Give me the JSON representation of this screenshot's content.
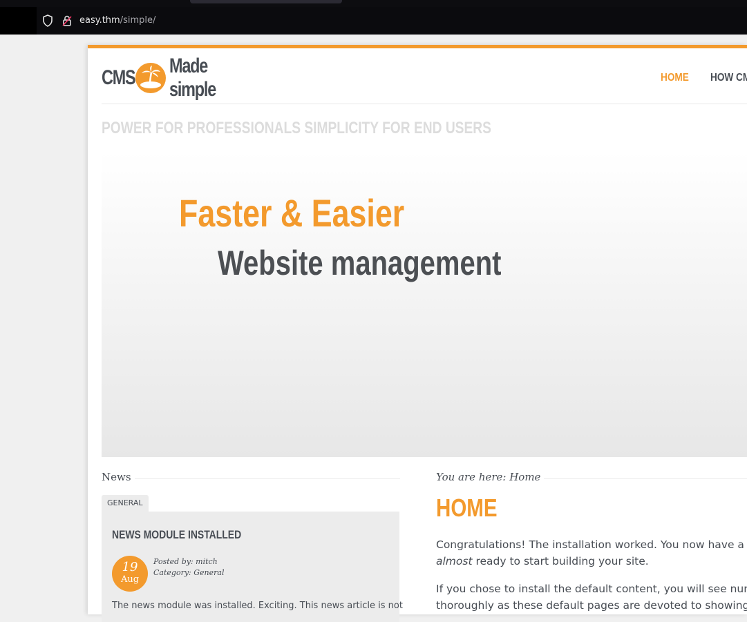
{
  "browser": {
    "url_host": "easy.thm",
    "url_path": "/simple/"
  },
  "site": {
    "logo_left": "CMS",
    "logo_right": "Made simple",
    "nav": [
      {
        "label": "HOME",
        "active": true
      },
      {
        "label": "HOW CMS",
        "active": false
      }
    ],
    "tagline": "POWER FOR PROFESSIONALS SIMPLICITY FOR END USERS",
    "hero": {
      "line1": "Faster & Easier",
      "line2": "Website management"
    }
  },
  "news": {
    "heading": "News",
    "category_tab": "GENERAL",
    "article": {
      "title": "NEWS MODULE INSTALLED",
      "day": "19",
      "month": "Aug",
      "posted_by": "Posted by: mitch",
      "category": "Category: General",
      "summary": "The news module was installed. Exciting. This news article is not"
    }
  },
  "main": {
    "breadcrumb": "You are here: Home",
    "title": "HOME",
    "p1_line1": "Congratulations! The installation worked. You now have a fu",
    "p1_em": "almost",
    "p1_line2_rest": " ready to start building your site.",
    "p2_line1": "If you chose to install the default content, you will see nume",
    "p2_line2": "thoroughly as these default pages are devoted to showing y"
  },
  "colors": {
    "accent": "#f39a2d",
    "text": "#474c53"
  }
}
